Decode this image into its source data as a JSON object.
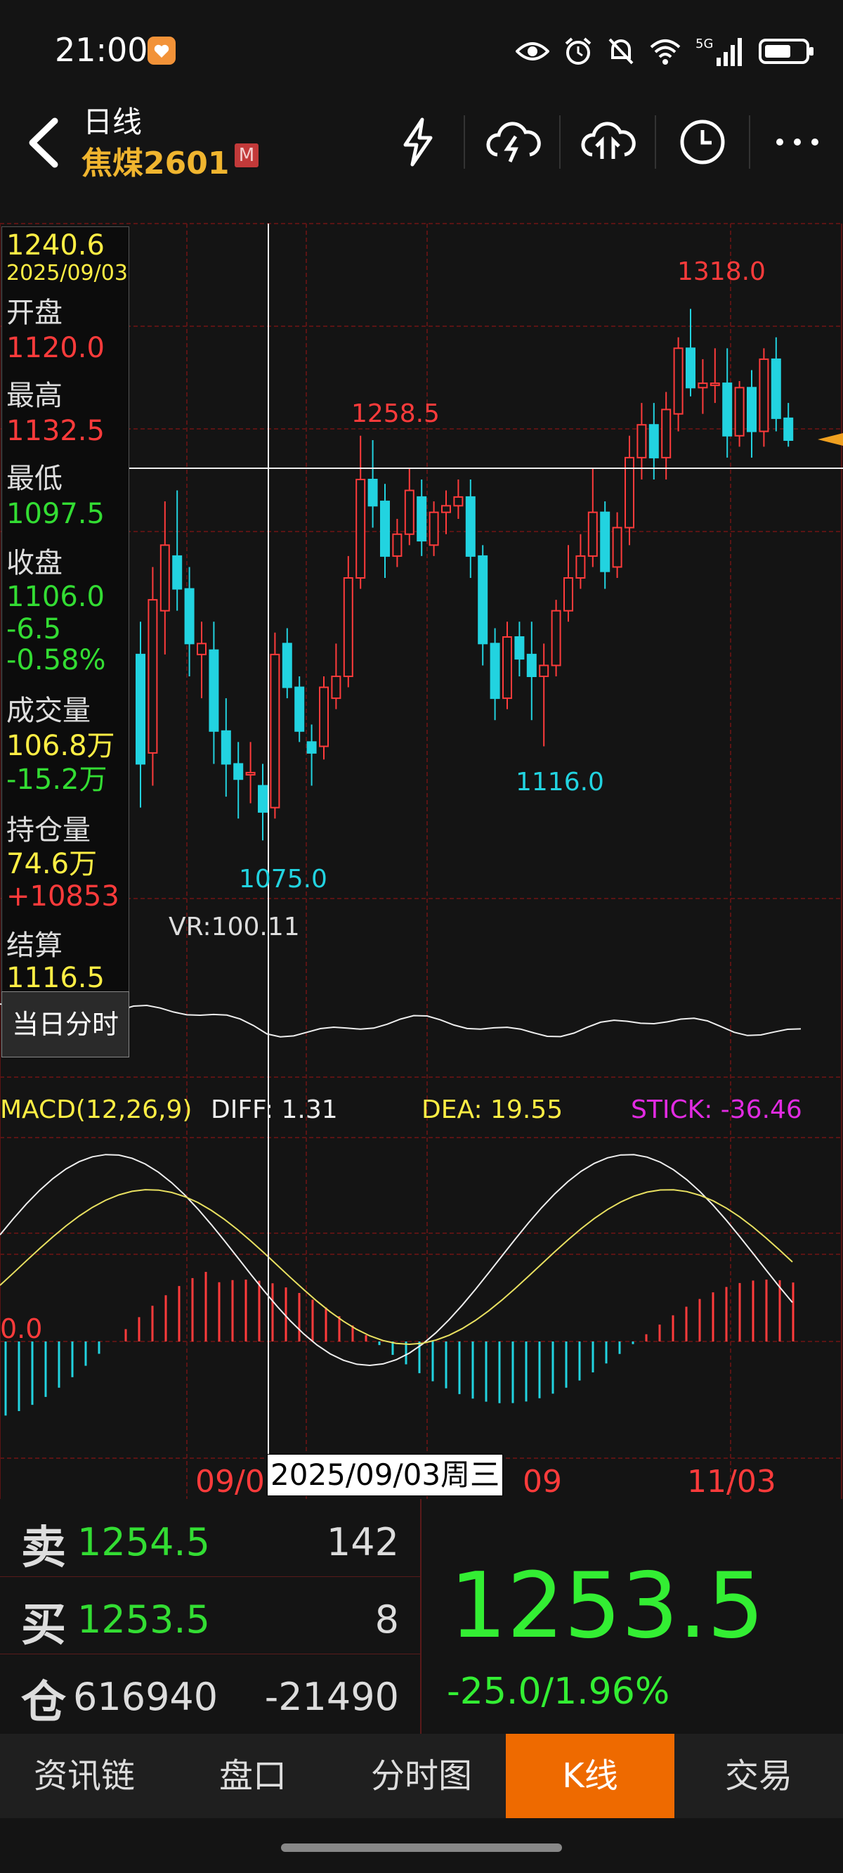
{
  "status": {
    "time": "21:00",
    "network": "5G"
  },
  "header": {
    "period": "日线",
    "symbol": "焦煤2601",
    "badge": "M"
  },
  "icons": [
    "back-icon",
    "lightning-icon",
    "cloud-download-icon",
    "cloud-upload-icon",
    "clock-icon",
    "more-icon"
  ],
  "info_panel": {
    "price": "1240.6",
    "date": "2025/09/03",
    "open_label": "开盘",
    "open": "1120.0",
    "high_label": "最高",
    "high": "1132.5",
    "low_label": "最低",
    "low": "1097.5",
    "close_label": "收盘",
    "close": "1106.0",
    "change": "-6.5",
    "change_pct": "-0.58%",
    "volume_label": "成交量",
    "volume": "106.8万",
    "volume_change": "-15.2万",
    "oi_label": "持仓量",
    "oi": "74.6万",
    "oi_change": "+10853",
    "settle_label": "结算",
    "settle": "1116.5",
    "intraday_btn": "当日分时"
  },
  "chart_labels": {
    "high_mark_1": "1258.5",
    "high_mark_2": "1318.0",
    "low_mark_1": "1075.0",
    "low_mark_2": "1116.0",
    "vr": "VR:100.11",
    "macd": "MACD(12,26,9)",
    "diff": "DIFF: 1.31",
    "dea": "DEA: 19.55",
    "stick": "STICK: -36.46",
    "macd_zero": "0.0",
    "x_left": "09/0",
    "x_cursor": "2025/09/03周三",
    "x_mid": "09",
    "x_right": "11/03"
  },
  "colors": {
    "up": "#ff3b3b",
    "down": "#22d3e0",
    "accent": "#ee6a00",
    "price_up": "#33ee33"
  },
  "quote": {
    "sell_label": "卖",
    "sell_price": "1254.5",
    "sell_vol": "142",
    "buy_label": "买",
    "buy_price": "1253.5",
    "buy_vol": "8",
    "pos_label": "仓",
    "pos_value": "616940",
    "pos_change": "-21490",
    "last_price": "1253.5",
    "last_change": "-25.0/1.96%"
  },
  "tabs": [
    "资讯链",
    "盘口",
    "分时图",
    "K线",
    "交易"
  ],
  "active_tab": 3,
  "chart_data": {
    "type": "candlestick",
    "ylim": [
      1060,
      1330
    ],
    "candles": [
      [
        1160,
        1175,
        1090,
        1110
      ],
      [
        1115,
        1200,
        1100,
        1185
      ],
      [
        1180,
        1230,
        1160,
        1210
      ],
      [
        1205,
        1235,
        1180,
        1190
      ],
      [
        1190,
        1200,
        1150,
        1165
      ],
      [
        1160,
        1175,
        1140,
        1165
      ],
      [
        1162,
        1175,
        1110,
        1125
      ],
      [
        1125,
        1140,
        1095,
        1110
      ],
      [
        1110,
        1120,
        1085,
        1103
      ],
      [
        1105,
        1120,
        1092,
        1106
      ],
      [
        1100,
        1110,
        1075,
        1088
      ],
      [
        1090,
        1170,
        1085,
        1160
      ],
      [
        1165,
        1172,
        1140,
        1145
      ],
      [
        1145,
        1150,
        1120,
        1125
      ],
      [
        1120,
        1128,
        1100,
        1115
      ],
      [
        1118,
        1150,
        1112,
        1145
      ],
      [
        1140,
        1165,
        1135,
        1150
      ],
      [
        1150,
        1205,
        1145,
        1195
      ],
      [
        1195,
        1260,
        1190,
        1240
      ],
      [
        1240,
        1258,
        1218,
        1228
      ],
      [
        1230,
        1238,
        1195,
        1205
      ],
      [
        1205,
        1222,
        1200,
        1215
      ],
      [
        1215,
        1245,
        1210,
        1235
      ],
      [
        1232,
        1240,
        1205,
        1212
      ],
      [
        1210,
        1230,
        1205,
        1225
      ],
      [
        1225,
        1235,
        1215,
        1228
      ],
      [
        1228,
        1240,
        1222,
        1232
      ],
      [
        1232,
        1240,
        1195,
        1205
      ],
      [
        1205,
        1210,
        1155,
        1165
      ],
      [
        1165,
        1172,
        1130,
        1140
      ],
      [
        1140,
        1175,
        1135,
        1168
      ],
      [
        1168,
        1175,
        1150,
        1158
      ],
      [
        1160,
        1175,
        1130,
        1150
      ],
      [
        1150,
        1165,
        1118,
        1155
      ],
      [
        1155,
        1185,
        1150,
        1180
      ],
      [
        1180,
        1210,
        1175,
        1195
      ],
      [
        1195,
        1215,
        1190,
        1205
      ],
      [
        1205,
        1245,
        1200,
        1225
      ],
      [
        1225,
        1230,
        1190,
        1198
      ],
      [
        1200,
        1225,
        1195,
        1218
      ],
      [
        1218,
        1260,
        1210,
        1250
      ],
      [
        1250,
        1275,
        1240,
        1265
      ],
      [
        1265,
        1275,
        1240,
        1250
      ],
      [
        1250,
        1280,
        1240,
        1272
      ],
      [
        1270,
        1305,
        1262,
        1300
      ],
      [
        1300,
        1318,
        1278,
        1282
      ],
      [
        1282,
        1295,
        1270,
        1284
      ],
      [
        1284,
        1300,
        1275,
        1284
      ],
      [
        1284,
        1300,
        1250,
        1260
      ],
      [
        1260,
        1285,
        1255,
        1282
      ],
      [
        1282,
        1290,
        1250,
        1262
      ],
      [
        1262,
        1300,
        1255,
        1295
      ],
      [
        1295,
        1305,
        1262,
        1268
      ],
      [
        1268,
        1275,
        1255,
        1258
      ]
    ]
  }
}
